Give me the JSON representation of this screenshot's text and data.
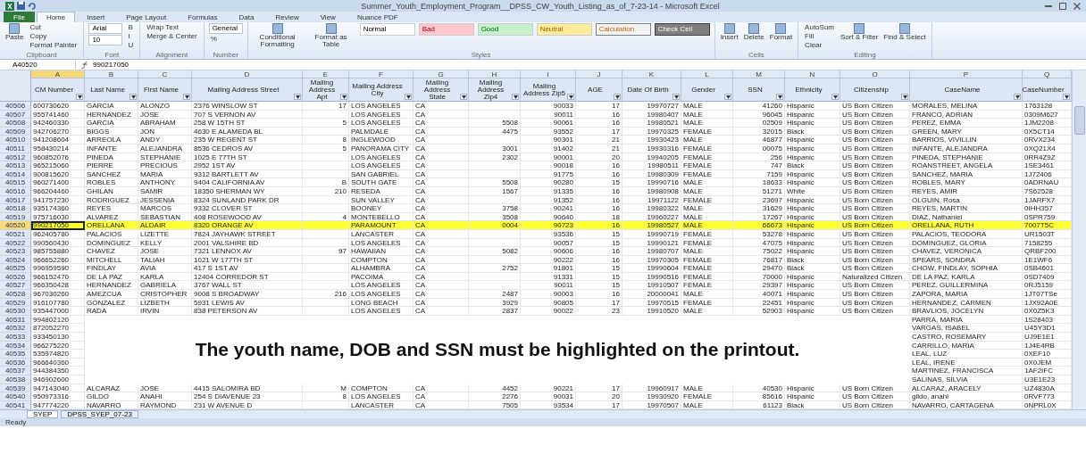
{
  "window": {
    "title": "Summer_Youth_Employment_Program__DPSS_CW_Youth_Listing_as_of_7-23-14 - Microsoft Excel"
  },
  "ribbon": {
    "tabs": [
      {
        "label": "File",
        "selected": false,
        "kind": "file"
      },
      {
        "label": "Home",
        "selected": true,
        "kind": "tab"
      },
      {
        "label": "Insert",
        "selected": false,
        "kind": "tab"
      },
      {
        "label": "Page Layout",
        "selected": false,
        "kind": "tab"
      },
      {
        "label": "Formulas",
        "selected": false,
        "kind": "tab"
      },
      {
        "label": "Data",
        "selected": false,
        "kind": "tab"
      },
      {
        "label": "Review",
        "selected": false,
        "kind": "tab"
      },
      {
        "label": "View",
        "selected": false,
        "kind": "tab"
      },
      {
        "label": "Nuance PDF",
        "selected": false,
        "kind": "tab"
      }
    ],
    "groups": [
      {
        "label": "Clipboard",
        "items": [
          {
            "label": "Paste",
            "kind": "big"
          },
          {
            "label": "Cut",
            "kind": "small"
          },
          {
            "label": "Copy",
            "kind": "small"
          },
          {
            "label": "Format Painter",
            "kind": "small"
          }
        ]
      },
      {
        "label": "Font",
        "items": [
          {
            "label": "Arial",
            "kind": "field"
          },
          {
            "label": "10",
            "kind": "field"
          },
          {
            "label": "B",
            "kind": "small"
          },
          {
            "label": "I",
            "kind": "small"
          },
          {
            "label": "U",
            "kind": "small"
          }
        ]
      },
      {
        "label": "Alignment",
        "items": [
          {
            "label": "Wrap Text",
            "kind": "small"
          },
          {
            "label": "Merge & Center",
            "kind": "small"
          }
        ]
      },
      {
        "label": "Number",
        "items": [
          {
            "label": "General",
            "kind": "field"
          },
          {
            "label": "%",
            "kind": "small"
          }
        ]
      },
      {
        "label": "Styles",
        "items": [
          {
            "label": "Conditional Formatting",
            "kind": "big"
          },
          {
            "label": "Format as Table",
            "kind": "big"
          },
          {
            "label": "Normal",
            "kind": "normal"
          },
          {
            "label": "Bad",
            "kind": "bad"
          },
          {
            "label": "Good",
            "kind": "good"
          },
          {
            "label": "Neutral",
            "kind": "neutral"
          },
          {
            "label": "Calculation",
            "kind": "calculation"
          },
          {
            "label": "Check Cell",
            "kind": "check"
          }
        ]
      },
      {
        "label": "Cells",
        "items": [
          {
            "label": "Insert",
            "kind": "big"
          },
          {
            "label": "Delete",
            "kind": "big"
          },
          {
            "label": "Format",
            "kind": "big"
          }
        ]
      },
      {
        "label": "Editing",
        "items": [
          {
            "label": "AutoSum",
            "kind": "small"
          },
          {
            "label": "Fill",
            "kind": "small"
          },
          {
            "label": "Clear",
            "kind": "small"
          },
          {
            "label": "Sort & Filter",
            "kind": "big"
          },
          {
            "label": "Find & Select",
            "kind": "big"
          }
        ]
      }
    ]
  },
  "formula_bar": {
    "name_box": "A40520",
    "formula": "990217050"
  },
  "sheet": {
    "column_letters": [
      "A",
      "B",
      "C",
      "D",
      "E",
      "F",
      "G",
      "H",
      "I",
      "J",
      "K",
      "L",
      "M",
      "N",
      "O",
      "P",
      "Q"
    ],
    "headers": [
      "CM Number",
      "Last Name",
      "First Name",
      "Mailing Address Street",
      "Mailing Address Apt",
      "Mailing Address City",
      "Mailing Address State",
      "Mailing Address Zip4",
      "Mailing Address Zip5",
      "AGE",
      "Date Of Birth",
      "Gender",
      "SSN",
      "Ethnicity",
      "Citizenship",
      "CaseName",
      "CaseNumber"
    ],
    "rows": [
      {
        "num": "40506",
        "selected": false,
        "cells": [
          "600730620",
          "GARCIA",
          "ALONZO",
          "2376 WINSLOW ST",
          "17",
          "LOS ANGELES",
          "CA",
          "",
          "90033",
          "17",
          "19970727",
          "MALE",
          "41260",
          "Hispanic",
          "US Born Citizen",
          "MORALES, MELINA",
          "1763128"
        ]
      },
      {
        "num": "40507",
        "selected": false,
        "cells": [
          "955741460",
          "HERNANDEZ",
          "JOSE",
          "707 S VERNON AV",
          "",
          "LOS ANGELES",
          "CA",
          "",
          "90011",
          "16",
          "19980407",
          "MALE",
          "96045",
          "Hispanic",
          "US Born Citizen",
          "FRANCO, ADRIAN",
          "0309M627"
        ]
      },
      {
        "num": "40508",
        "selected": false,
        "cells": [
          "942460330",
          "GARCIA",
          "ABRAHAM",
          "258 W 15TH ST",
          "5",
          "LOS ANGELES",
          "CA",
          "5508",
          "90061",
          "16",
          "19980521",
          "MALE",
          "02509",
          "Hispanic",
          "US Born Citizen",
          "PEREZ, EMMA",
          "1JM2208"
        ]
      },
      {
        "num": "40509",
        "selected": false,
        "cells": [
          "942706270",
          "BIGGS",
          "JON",
          "4630 E ALAMEDA BL",
          "",
          "PALMDALE",
          "CA",
          "4475",
          "93552",
          "17",
          "19970325",
          "FEMALE",
          "32015",
          "Black",
          "US Born Citizen",
          "GREEN, MARY",
          "0X5CT14"
        ]
      },
      {
        "num": "40510",
        "selected": false,
        "cells": [
          "941208604",
          "ARREOLA",
          "ANDY",
          "235 W REGENT ST",
          "8",
          "INGLEWOOD",
          "CA",
          "",
          "90301",
          "21",
          "19930423",
          "MALE",
          "46877",
          "Hispanic",
          "US Born Citizen",
          "BARRIOS, VIVILLIN",
          "0RVX234"
        ]
      },
      {
        "num": "40511",
        "selected": false,
        "cells": [
          "958430214",
          "INFANTE",
          "ALEJANDRA",
          "8536 CEDROS AV",
          "5",
          "PANORAMA CITY",
          "CA",
          "3001",
          "91402",
          "21",
          "19930316",
          "FEMALE",
          "00075",
          "Hispanic",
          "US Born Citizen",
          "INFANTE, ALEJANDRA",
          "0XQ21X4"
        ]
      },
      {
        "num": "40512",
        "selected": false,
        "cells": [
          "960852076",
          "PINEDA",
          "STEPHANIE",
          "1025 E 77TH ST",
          "",
          "LOS ANGELES",
          "CA",
          "2302",
          "90001",
          "20",
          "19940205",
          "FEMALE",
          "256",
          "Hispanic",
          "US Born Citizen",
          "PINEDA, STEPHANIE",
          "0RR4Z9Z"
        ]
      },
      {
        "num": "40513",
        "selected": false,
        "cells": [
          "965215060",
          "PIERRE",
          "PRECIOUS",
          "2952 1ST AV",
          "",
          "LOS ANGELES",
          "CA",
          "",
          "90018",
          "16",
          "19980511",
          "FEMALE",
          "747",
          "Black",
          "US Born Citizen",
          "ROANSTREET, ANGELA",
          "1SE3461"
        ]
      },
      {
        "num": "40514",
        "selected": false,
        "cells": [
          "900815620",
          "SANCHEZ",
          "MARIA",
          "9312 BARTLETT AV",
          "",
          "SAN GABRIEL",
          "CA",
          "",
          "91775",
          "16",
          "19980309",
          "FEMALE",
          "7159",
          "Hispanic",
          "US Born Citizen",
          "SANCHEZ, MARIA",
          "1J72406"
        ]
      },
      {
        "num": "40515",
        "selected": false,
        "cells": [
          "960271400",
          "ROBLES",
          "ANTHONY",
          "9404 CALIFORNIA AV",
          "B",
          "SOUTH GATE",
          "CA",
          "5508",
          "90280",
          "15",
          "19990716",
          "MALE",
          "18633",
          "Hispanic",
          "US Born Citizen",
          "ROBLES, MARY",
          "0ADRNAU"
        ]
      },
      {
        "num": "40516",
        "selected": false,
        "cells": [
          "966204460",
          "GHILAN",
          "SAMIR",
          "18350 SHERMAN WY",
          "210",
          "RESEDA",
          "CA",
          "1567",
          "91335",
          "16",
          "19980908",
          "MALE",
          "51271",
          "White",
          "US Born Citizen",
          "REYES, AMIR",
          "7S62528"
        ]
      },
      {
        "num": "40517",
        "selected": false,
        "cells": [
          "941757230",
          "RODRIGUEZ",
          "JESSENIA",
          "8324 SUNLAND PARK DR",
          "",
          "SUN VALLEY",
          "CA",
          "",
          "91352",
          "16",
          "19971122",
          "FEMALE",
          "23697",
          "Hispanic",
          "US Born Citizen",
          "OLGUIN, Rosa",
          "1JARFX7"
        ]
      },
      {
        "num": "40518",
        "selected": false,
        "cells": [
          "935174360",
          "REYES",
          "MARCOS",
          "9332 CLOVER ST",
          "",
          "BOONEY",
          "CA",
          "3758",
          "90241",
          "16",
          "19980322",
          "MALE",
          "31629",
          "Hispanic",
          "US Born Citizen",
          "REYES, MARTIN",
          "0IHH357"
        ]
      },
      {
        "num": "40519",
        "selected": false,
        "cells": [
          "975716030",
          "ALVAREZ",
          "SEBASTIAN",
          "408 ROSEWOOD AV",
          "4",
          "MONTEBELLO",
          "CA",
          "3508",
          "90640",
          "18",
          "19960227",
          "MALE",
          "17267",
          "Hispanic",
          "US Born Citizen",
          "DIAZ, Nathaniel",
          "0SPR759"
        ]
      },
      {
        "num": "40520",
        "selected": true,
        "cells": [
          "990217050",
          "ORELLANA",
          "ALDAIR",
          "8320 ORANGE AV",
          "",
          "PARAMOUNT",
          "CA",
          "0004",
          "90723",
          "16",
          "19980527",
          "MALE",
          "66673",
          "Hispanic",
          "US Born Citizen",
          "ORELLANA, RUTH",
          "7007T5C"
        ]
      },
      {
        "num": "40521",
        "selected": false,
        "cells": [
          "962405780",
          "PALACIOS",
          "LIZETTE",
          "7824 JAYHAWK STREET",
          "",
          "LANCASTER",
          "CA",
          "",
          "93536",
          "15",
          "19990719",
          "FEMALE",
          "53278",
          "Hispanic",
          "US Born Citizen",
          "PALACIOS, TEODORA",
          "UR1503T"
        ]
      },
      {
        "num": "40522",
        "selected": false,
        "cells": [
          "990560430",
          "DOMINGUEZ",
          "KELLY",
          "2001 VALSHIRE BD",
          "",
          "LOS ANGELES",
          "CA",
          "",
          "90057",
          "15",
          "19990121",
          "FEMALE",
          "47075",
          "Hispanic",
          "US Born Citizen",
          "DOMINGUEZ, GLORIA",
          "7158255"
        ]
      },
      {
        "num": "40523",
        "selected": false,
        "cells": [
          "985755880",
          "CHAVEZ",
          "JOSE",
          "7321 LENNOX AV",
          "97",
          "HAWAIIAN",
          "CA",
          "5082",
          "90606",
          "16",
          "19980707",
          "MALE",
          "75022",
          "Hispanic",
          "US Born Citizen",
          "CHAVEZ, VERONICA",
          "QRBF200"
        ]
      },
      {
        "num": "40524",
        "selected": false,
        "cells": [
          "966652260",
          "MITCHELL",
          "TALIAH",
          "1021 W 177TH ST",
          "",
          "COMPTON",
          "CA",
          "",
          "90222",
          "16",
          "19970305",
          "FEMALE",
          "76817",
          "Black",
          "US Born Citizen",
          "SPEARS, SONDRA",
          "1E1WF6"
        ]
      },
      {
        "num": "40525",
        "selected": false,
        "cells": [
          "996959590",
          "FINDLAY",
          "AVIA",
          "417 S 1ST AV",
          "",
          "ALHAMBRA",
          "CA",
          "2752",
          "91801",
          "15",
          "19990604",
          "FEMALE",
          "29470",
          "Black",
          "US Born Citizen",
          "CHOW, FINDLAY, SOPHIA",
          "0SB4601"
        ]
      },
      {
        "num": "40526",
        "selected": false,
        "cells": [
          "966152470",
          "DE LA PAZ",
          "KARLA",
          "12404 CORREDOR ST",
          "",
          "PACOIMA",
          "CA",
          "",
          "91331",
          "15",
          "19990516",
          "FEMALE",
          "70000",
          "Hispanic",
          "Naturalized Citizen",
          "DE LA PAZ, KARLA",
          "0SD7409"
        ]
      },
      {
        "num": "40527",
        "selected": false,
        "cells": [
          "966350428",
          "HERNANDEZ",
          "GABRIELA",
          "3767 WALL ST",
          "",
          "LOS ANGELES",
          "CA",
          "",
          "90011",
          "15",
          "19910507",
          "FEMALE",
          "29397",
          "Hispanic",
          "US Born Citizen",
          "PEREZ, GUILLERMINA",
          "0RJ5159"
        ]
      },
      {
        "num": "40528",
        "selected": false,
        "cells": [
          "967030260",
          "AMEZCUA",
          "CRISTOPHER",
          "9008 S BROADWAY",
          "216",
          "LOS ANGELES",
          "CA",
          "2487",
          "90003",
          "16",
          "20000041",
          "MALE",
          "40071",
          "Hispanic",
          "US Born Citizen",
          "ZAPORA, MARIA",
          "1JT07TSe"
        ]
      },
      {
        "num": "40529",
        "selected": false,
        "cells": [
          "916107780",
          "GONZALEZ",
          "LIZBETH",
          "5931 LEWIS AV",
          "",
          "LONG BEACH",
          "CA",
          "3929",
          "90805",
          "17",
          "19970515",
          "FEMALE",
          "22451",
          "Hispanic",
          "US Born Citizen",
          "HERNANDEZ, CARMEN",
          "1JX92A0E"
        ]
      },
      {
        "num": "40530",
        "selected": false,
        "cells": [
          "935447000",
          "RADA",
          "IRVIN",
          "838 PETERSON AV",
          "",
          "LOS ANGELES",
          "CA",
          "2837",
          "90022",
          "23",
          "19910520",
          "MALE",
          "52903",
          "Hispanic",
          "US Born Citizen",
          "BRAVLIOS, JOCELYN",
          "0X0Z5K3"
        ]
      },
      {
        "num": "40531",
        "selected": false,
        "cells": [
          "994802120",
          null,
          null,
          null,
          null,
          null,
          null,
          null,
          null,
          null,
          null,
          null,
          null,
          null,
          null,
          "PARRA, MARIA",
          "1S28403"
        ]
      },
      {
        "num": "40532",
        "selected": false,
        "cells": [
          "872052270",
          null,
          null,
          null,
          null,
          null,
          null,
          null,
          null,
          null,
          null,
          null,
          null,
          null,
          null,
          "VARGAS, ISABEL",
          "U45Y3D1"
        ]
      },
      {
        "num": "40533",
        "selected": false,
        "cells": [
          "933450130",
          null,
          null,
          null,
          null,
          null,
          null,
          null,
          null,
          null,
          null,
          null,
          null,
          null,
          null,
          "CASTRO, ROSEMARY",
          "UJ9E1E1"
        ]
      },
      {
        "num": "40534",
        "selected": false,
        "cells": [
          "966275220",
          null,
          null,
          null,
          null,
          null,
          null,
          null,
          null,
          null,
          null,
          null,
          null,
          null,
          null,
          "CARRILLO, MARIA",
          "1J4E4RB"
        ]
      },
      {
        "num": "40535",
        "selected": false,
        "cells": [
          "535974820",
          null,
          null,
          null,
          null,
          null,
          null,
          null,
          null,
          null,
          null,
          null,
          null,
          null,
          null,
          "LEAL, LUZ",
          "0XEF10"
        ]
      },
      {
        "num": "40536",
        "selected": false,
        "cells": [
          "966640360",
          null,
          null,
          null,
          null,
          null,
          null,
          null,
          null,
          null,
          null,
          null,
          null,
          null,
          null,
          "LEAL, IRENE",
          "0X0JEM"
        ]
      },
      {
        "num": "40537",
        "selected": false,
        "cells": [
          "944384350",
          null,
          null,
          null,
          null,
          null,
          null,
          null,
          null,
          null,
          null,
          null,
          null,
          null,
          null,
          "MARTINEZ, FRANCISCA",
          "1AF2IFC"
        ]
      },
      {
        "num": "40538",
        "selected": false,
        "cells": [
          "946902600",
          null,
          null,
          null,
          null,
          null,
          null,
          null,
          null,
          null,
          null,
          null,
          null,
          null,
          null,
          "SALINAS, SILVIA",
          "U3E1E23"
        ]
      },
      {
        "num": "40539",
        "selected": false,
        "cells": [
          "947143040",
          "ALCARAZ",
          "JOSE",
          "4415 SALOMIRA BD",
          "M",
          "COMPTON",
          "CA",
          "4452",
          "90221",
          "17",
          "19960917",
          "MALE",
          "40530",
          "Hispanic",
          "US Born Citizen",
          "ALCARAZ, ARACELY",
          "UZ4830A"
        ]
      },
      {
        "num": "40540",
        "selected": false,
        "cells": [
          "950973316",
          "GILDO",
          "ANAHI",
          "254 S DIAVENUE 23",
          "8",
          "LOS ANGELES",
          "CA",
          "2276",
          "90031",
          "20",
          "19930920",
          "FEMALE",
          "85616",
          "Hispanic",
          "US Born Citizen",
          "gildo, anahi",
          "0RVF773"
        ]
      },
      {
        "num": "40541",
        "selected": false,
        "cells": [
          "947774220",
          "NAVARRO",
          "RAYMOND",
          "231 W AVENUE D",
          "",
          "LANCASTER",
          "CA",
          "7505",
          "93534",
          "17",
          "19970507",
          "MALE",
          "61123",
          "Black",
          "US Born Citizen",
          "NAVARRO, CARTAGENA",
          "0NPRL0X"
        ]
      }
    ],
    "callout": {
      "text": "The youth name, DOB and SSN must be highlighted on the printout."
    }
  },
  "sheet_tabs": [
    {
      "label": "SYEP",
      "selected": true
    },
    {
      "label": "DPSS_SYEP_07-23",
      "selected": false
    }
  ],
  "status_bar": {
    "text": "Ready"
  }
}
